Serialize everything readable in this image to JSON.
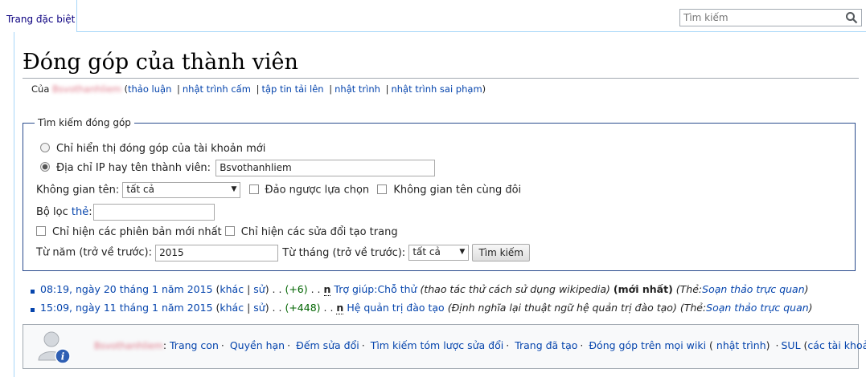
{
  "tab": {
    "label": "Trang đặc biệt"
  },
  "search": {
    "placeholder": "Tìm kiếm"
  },
  "page": {
    "title": "Đóng góp của thành viên"
  },
  "subtitle": {
    "prefix": "Của",
    "user": "Bsvothanhliem",
    "links": [
      "thảo luận",
      "nhật trình cấm",
      "tập tin tải lên",
      "nhật trình",
      "nhật trình sai phạm"
    ]
  },
  "form": {
    "legend": "Tìm kiếm đóng góp",
    "radio_new_accounts": "Chỉ hiển thị đóng góp của tài khoản mới",
    "radio_ip_user": "Địa chỉ IP hay tên thành viên:",
    "user_value": "Bsvothanhliem",
    "namespace_label": "Không gian tên:",
    "namespace_value": "tất cả",
    "invert_label": "Đảo ngược lựa chọn",
    "associated_label": "Không gian tên cùng đôi",
    "filter_label": "Bộ lọc",
    "filter_link": "thẻ",
    "latest_only_label": "Chỉ hiện các phiên bản mới nhất",
    "page_creations_label": "Chỉ hiện các sửa đổi tạo trang",
    "year_label": "Từ năm (trở về trước):",
    "year_value": "2015",
    "month_label": "Từ tháng (trở về trước):",
    "month_value": "tất cả",
    "submit_label": "Tìm kiếm"
  },
  "contributions": [
    {
      "time": "08:19, ngày 20 tháng 1 năm 2015",
      "diff": "khác",
      "hist": "sử",
      "size": "(+6)",
      "flag": "n",
      "page": "Trợ giúp:Chỗ thử",
      "comment": "(thao tác thử cách sử dụng wikipedia)",
      "latest": "(mới nhất)",
      "tag_prefix": "(Thẻ:",
      "tag": "Soạn thảo trực quan",
      "tag_suffix": ")"
    },
    {
      "time": "15:09, ngày 11 tháng 1 năm 2015",
      "diff": "khác",
      "hist": "sử",
      "size": "(+448)",
      "flag": "n",
      "page": "Hệ quản trị đào tạo",
      "comment": "(Định nghĩa lại thuật ngữ hệ quản trị đào tạo)",
      "latest": "",
      "tag_prefix": "(Thẻ:",
      "tag": "Soạn thảo trực quan",
      "tag_suffix": ")"
    }
  ],
  "footer": {
    "user": "Bsvothanhliem",
    "links": [
      "Trang con",
      "Quyền hạn",
      "Đếm sửa đổi",
      "Tìm kiếm tóm lược sửa đổi",
      "Trang đã tạo",
      "Đóng góp trên mọi wiki"
    ],
    "log_link": "nhật trình",
    "sul": "SUL",
    "accounts_link": "các tài khoản"
  }
}
